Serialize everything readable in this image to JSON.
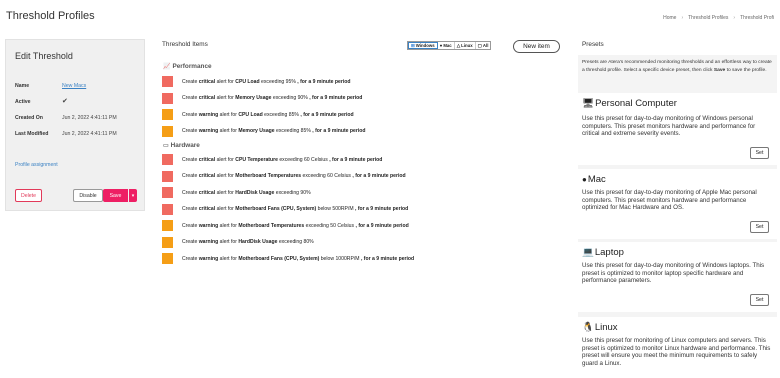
{
  "header": {
    "title": "Threshold Profiles",
    "breadcrumb": [
      "Home",
      "Threshold Profiles",
      "Threshold Profi"
    ]
  },
  "edit": {
    "title": "Edit Threshold",
    "fields": {
      "name_label": "Name",
      "name_value": "New Macs",
      "active_label": "Active",
      "created_label": "Created On",
      "created_value": "Jun 2, 2022 4:41:11 PM",
      "modified_label": "Last Modified",
      "modified_value": "Jun 2, 2022 4:41:11 PM"
    },
    "profile_link": "Profile assignment",
    "delete_label": "Delete",
    "disable_label": "Disable",
    "save_label": "Save",
    "save_dropdown": "▾"
  },
  "items": {
    "title": "Threshold Items",
    "os_filters": [
      "Windows",
      "Mac",
      "Linux",
      "All"
    ],
    "new_item_label": "New item",
    "colors": {
      "critical": "#f06a60",
      "warning": "#f59e16"
    },
    "sections": [
      {
        "name": "Performance",
        "rows": [
          {
            "level": "critical",
            "pre": "Create ",
            "sev": "critical",
            "mid": " alert for ",
            "metric": "CPU Load",
            "cond": " exceeding 95% ",
            "period": ", for a 9 minute period"
          },
          {
            "level": "critical",
            "pre": "Create ",
            "sev": "critical",
            "mid": " alert for ",
            "metric": "Memory Usage",
            "cond": " exceeding 90% ",
            "period": ", for a 9 minute period"
          },
          {
            "level": "warning",
            "pre": "Create ",
            "sev": "warning",
            "mid": " alert for ",
            "metric": "CPU Load",
            "cond": " exceeding 85% ",
            "period": ", for a 9 minute period"
          },
          {
            "level": "warning",
            "pre": "Create ",
            "sev": "warning",
            "mid": " alert for ",
            "metric": "Memory Usage",
            "cond": " exceeding 85% ",
            "period": ", for a 9 minute period"
          }
        ]
      },
      {
        "name": "Hardware",
        "rows": [
          {
            "level": "critical",
            "pre": "Create ",
            "sev": "critical",
            "mid": " alert for ",
            "metric": "CPU Temperature",
            "cond": " exceeding 60 Celsius ",
            "period": ", for a 9 minute period"
          },
          {
            "level": "critical",
            "pre": "Create ",
            "sev": "critical",
            "mid": " alert for ",
            "metric": "Motherboard Temperatures",
            "cond": " exceeding 60 Celsius ",
            "period": ", for a 9 minute period"
          },
          {
            "level": "critical",
            "pre": "Create ",
            "sev": "critical",
            "mid": " alert for ",
            "metric": "HardDisk Usage",
            "cond": " exceeding 90%",
            "period": ""
          },
          {
            "level": "critical",
            "pre": "Create ",
            "sev": "critical",
            "mid": " alert for ",
            "metric": "Motherboard Fans (CPU, System)",
            "cond": " below 500RP/M ",
            "period": ", for a 9 minute period"
          },
          {
            "level": "warning",
            "pre": "Create ",
            "sev": "warning",
            "mid": " alert for ",
            "metric": "Motherboard Temperatures",
            "cond": " exceeding 50 Celsius ",
            "period": ", for a 9 minute period"
          },
          {
            "level": "warning",
            "pre": "Create ",
            "sev": "warning",
            "mid": " alert for ",
            "metric": "HardDisk Usage",
            "cond": " exceeding 80%",
            "period": ""
          },
          {
            "level": "warning",
            "pre": "Create ",
            "sev": "warning",
            "mid": " alert for ",
            "metric": "Motherboard Fans (CPU, System)",
            "cond": " below 1000RP/M ",
            "period": ", for a 9 minute period"
          }
        ]
      }
    ]
  },
  "presets": {
    "title": "Presets",
    "intro_1": "Presets are Atera's recommended monitoring thresholds and an effortless way to create a threshold profile. Select a specific device preset, then click ",
    "intro_bold": "Save",
    "intro_2": " to save the profile.",
    "set_label": "Set",
    "list": [
      {
        "name": "Personal Computer",
        "icon": "monitor-icon",
        "desc": "Use this preset for day-to-day monitoring of Windows personal computers. This preset monitors hardware and performance for critical and extreme severity events."
      },
      {
        "name": "Mac",
        "icon": "apple-icon",
        "desc": "Use this preset for day-to-day monitoring of Apple Mac personal computers. This preset monitors hardware and performance optimized for Mac Hardware and OS."
      },
      {
        "name": "Laptop",
        "icon": "laptop-icon",
        "desc": "Use this preset for day-to-day monitoring of Windows laptops. This preset is optimized to monitor laptop specific hardware and performance parameters."
      },
      {
        "name": "Linux",
        "icon": "linux-icon",
        "desc": "Use this preset for monitoring of Linux computers and servers. This preset is optimized to monitor Linux hardware and performance. This preset will ensure you meet the minimum requirements to safely guard a Linux."
      }
    ]
  }
}
